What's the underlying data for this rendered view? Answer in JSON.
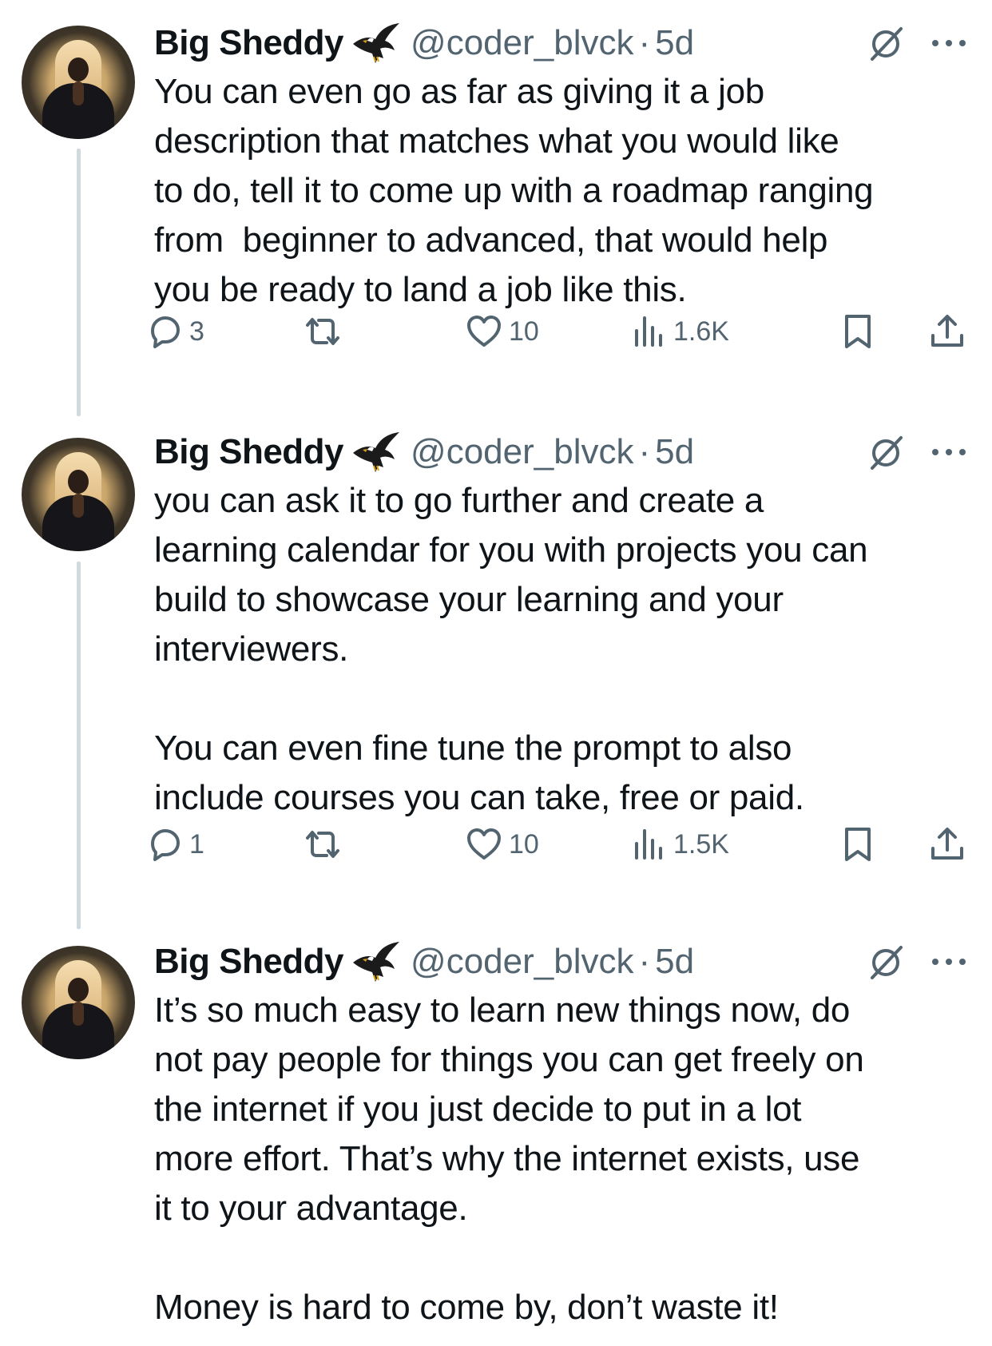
{
  "tweets": [
    {
      "author": "Big Sheddy",
      "handle": "@coder_blvck",
      "separator": "·",
      "time": "5d",
      "text": "You can even go as far as giving it a job\ndescription that matches what you would like\nto do, tell it to come up with a roadmap ranging\nfrom  beginner to advanced, that would help\nyou be ready to land a job like this.",
      "replies": "3",
      "retweets": "",
      "likes": "10",
      "views": "1.6K"
    },
    {
      "author": "Big Sheddy",
      "handle": "@coder_blvck",
      "separator": "·",
      "time": "5d",
      "text": "you can ask it to go further and create a\nlearning calendar for you with projects you can\nbuild to showcase your learning and your\ninterviewers.\n\nYou can even fine tune the prompt to also\ninclude courses you can take, free or paid.",
      "replies": "1",
      "retweets": "",
      "likes": "10",
      "views": "1.5K"
    },
    {
      "author": "Big Sheddy",
      "handle": "@coder_blvck",
      "separator": "·",
      "time": "5d",
      "text": "It’s so much easy to learn new things now, do\nnot pay people for things you can get freely on\nthe internet if you just decide to put in a lot\nmore effort. That’s why the internet exists, use\nit to your advantage.\n\nMoney is hard to come by, don’t waste it!"
    }
  ],
  "icons": {
    "badge": "eagle-icon",
    "grok": "grok-icon",
    "more": "more-icon",
    "reply": "reply-icon",
    "retweet": "retweet-icon",
    "like": "like-icon",
    "views": "views-icon",
    "bookmark": "bookmark-icon",
    "share": "share-icon"
  },
  "colors": {
    "text": "#0f1419",
    "muted": "#536471",
    "thread_line": "#cfd9de",
    "background": "#ffffff"
  }
}
